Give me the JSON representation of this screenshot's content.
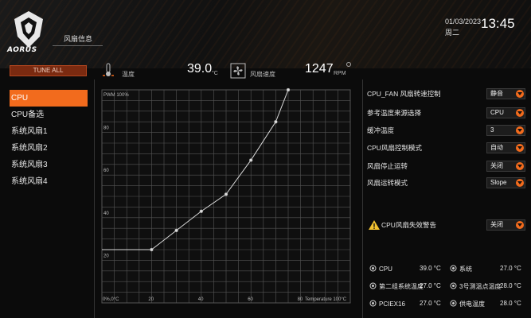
{
  "brand": {
    "logo_text": "AORUS"
  },
  "header": {
    "tab_label": "风扇信息",
    "date": "01/03/2023",
    "weekday": "周二",
    "time": "13:45"
  },
  "left_panel": {
    "tune_all_label": "TUNE ALL",
    "items": [
      {
        "label": "CPU",
        "active": true
      },
      {
        "label": "CPU备选"
      },
      {
        "label": "系统风扇1"
      },
      {
        "label": "系统风扇2"
      },
      {
        "label": "系统风扇3"
      },
      {
        "label": "系统风扇4"
      }
    ]
  },
  "readout": {
    "temp_label": "温度",
    "temp_value": "39.0",
    "temp_unit": "°C",
    "fan_label": "风扇速度",
    "fan_value": "1247",
    "fan_unit": "RPM"
  },
  "chart_data": {
    "type": "line",
    "y_title": "PWM 100%",
    "x_title": "Temperature 100°C",
    "origin_label": "0%,0°C",
    "x_ticks": [
      20,
      40,
      60,
      80
    ],
    "y_ticks": [
      20,
      40,
      60,
      80
    ],
    "xlim": [
      0,
      100
    ],
    "ylim": [
      0,
      100
    ],
    "grid": true,
    "series": [
      {
        "x": [
          0,
          20,
          30,
          40,
          50,
          60,
          70,
          75
        ],
        "y": [
          25,
          25,
          34,
          43,
          51,
          67,
          85,
          100
        ]
      }
    ]
  },
  "settings": [
    {
      "label": "CPU_FAN 风扇转速控制",
      "value": "静音"
    },
    {
      "label": "参考温度来源选择",
      "value": "CPU"
    },
    {
      "label": "缓冲温度",
      "value": "3"
    },
    {
      "label": "CPU风扇控制模式",
      "value": "自动"
    },
    {
      "label": "风扇停止运转",
      "value": "关闭"
    },
    {
      "label": "风扇运转模式",
      "value": "Slope"
    }
  ],
  "warning": {
    "label": "CPU风扇失效警告",
    "value": "关闭"
  },
  "sensors": [
    {
      "name": "CPU",
      "value": "39.0 °C"
    },
    {
      "name": "系统",
      "value": "27.0 °C"
    },
    {
      "name": "第二组系统温度",
      "value": "27.0 °C"
    },
    {
      "name": "3号测温点温度",
      "value": "28.0 °C"
    },
    {
      "name": "PCIEX16",
      "value": "27.0 °C"
    },
    {
      "name": "供电温度",
      "value": "28.0 °C"
    }
  ],
  "colors": {
    "accent": "#f26b1d",
    "chart_line": "#d9d9d9",
    "grid": "#555555",
    "background": "#0b0b0b"
  }
}
